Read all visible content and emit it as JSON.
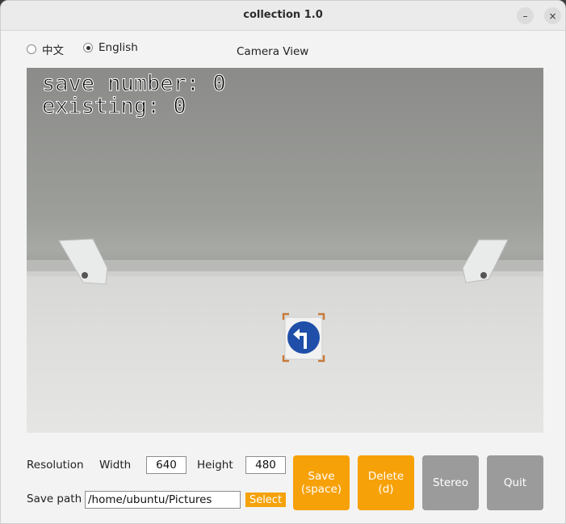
{
  "window": {
    "title": "collection 1.0",
    "minimize_label": "–",
    "close_label": "×"
  },
  "language": {
    "options": [
      {
        "label": "中文",
        "selected": false
      },
      {
        "label": "English",
        "selected": true
      }
    ]
  },
  "camera": {
    "label": "Camera View",
    "overlay": {
      "save_number": "save number: 0",
      "existing": "existing: 0"
    }
  },
  "settings": {
    "resolution_label": "Resolution",
    "width_label": "Width",
    "width_value": "640",
    "height_label": "Height",
    "height_value": "480",
    "save_path_label": "Save path",
    "save_path_value": "/home/ubuntu/Pictures",
    "select_label": "Select"
  },
  "buttons": {
    "save": {
      "line1": "Save",
      "line2": "(space)"
    },
    "delete": {
      "line1": "Delete",
      "line2": "(d)"
    },
    "stereo": "Stereo",
    "quit": "Quit"
  },
  "colors": {
    "accent": "#f7a108",
    "disabled": "#9b9b9b"
  }
}
